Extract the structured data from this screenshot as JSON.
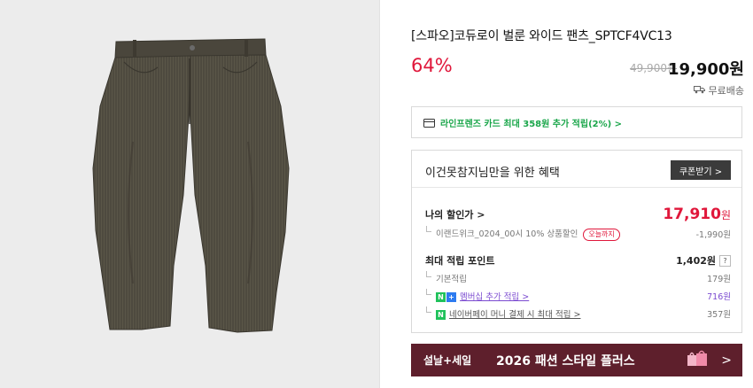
{
  "product": {
    "title": "[스파오]코듀로이 벌룬 와이드 팬츠_SPTCF4VC13",
    "discount": "64%",
    "original_price": "49,900원",
    "price": "19,900원",
    "shipping": "무료배송"
  },
  "card_banner": {
    "text": "라인프렌즈 카드 최대 358원 추가 적립(2%) >"
  },
  "benefit": {
    "title": "이건못참지님만을 위한 혜택",
    "coupon_button": "쿠폰받기 >",
    "my_discount_label": "나의 할인가 >",
    "my_discount_value": "17,910",
    "my_discount_unit": "원",
    "coupon_label": "이랜드위크_0204_00시 10% 상품할인",
    "coupon_pill": "오늘까지",
    "coupon_value": "-1,990원",
    "max_point_label": "최대 적립 포인트",
    "max_point_value": "1,402원",
    "max_point_help": "?",
    "basic_point_label": "기본적립",
    "basic_point_value": "179원",
    "membership_label": "멤버십 추가 적립 >",
    "membership_value": "716원",
    "npay_label": "네이버페이 머니 결제 시 최대 적립 >",
    "npay_value": "357원",
    "badge_n": "N",
    "badge_plus": "+",
    "badge_pay": "N"
  },
  "promo": {
    "left_text": "설날+세일",
    "mid_text": "2026 패션 스타일 플러스",
    "arrow": ">"
  },
  "colors": {
    "accent_red": "#e0173b",
    "green": "#1aa64a",
    "purple": "#7b4bd0",
    "promo_bg": "#5e1f2c",
    "coupon_btn_bg": "#3b3b3b"
  },
  "icons": {
    "card": "credit-card-icon",
    "truck": "delivery-truck-icon",
    "gift": "gift-bag-icon"
  }
}
